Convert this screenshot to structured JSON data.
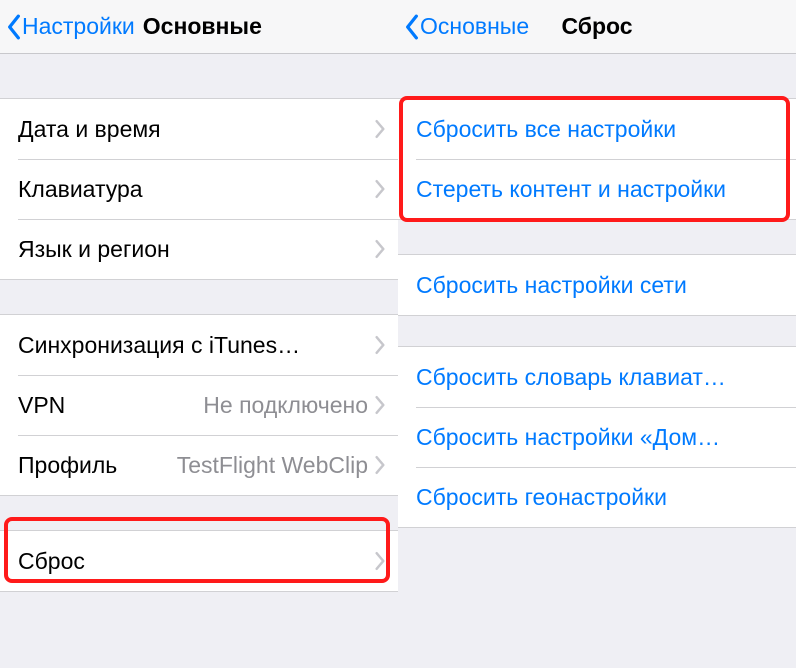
{
  "left": {
    "back_label": "Настройки",
    "title": "Основные",
    "group1": [
      {
        "label": "Дата и время"
      },
      {
        "label": "Клавиатура"
      },
      {
        "label": "Язык и регион"
      }
    ],
    "group2": [
      {
        "label": "Синхронизация с iTunes…"
      },
      {
        "label": "VPN",
        "value": "Не подключено"
      },
      {
        "label": "Профиль",
        "value": "TestFlight WebClip"
      }
    ],
    "group3": [
      {
        "label": "Сброс"
      }
    ]
  },
  "right": {
    "back_label": "Основные",
    "title": "Сброс",
    "group1": [
      {
        "label": "Сбросить все настройки"
      },
      {
        "label": "Стереть контент и настройки"
      }
    ],
    "group2": [
      {
        "label": "Сбросить настройки сети"
      }
    ],
    "group3": [
      {
        "label": "Сбросить словарь клавиат…"
      },
      {
        "label": "Сбросить настройки «Дом…"
      },
      {
        "label": "Сбросить геонастройки"
      }
    ]
  }
}
